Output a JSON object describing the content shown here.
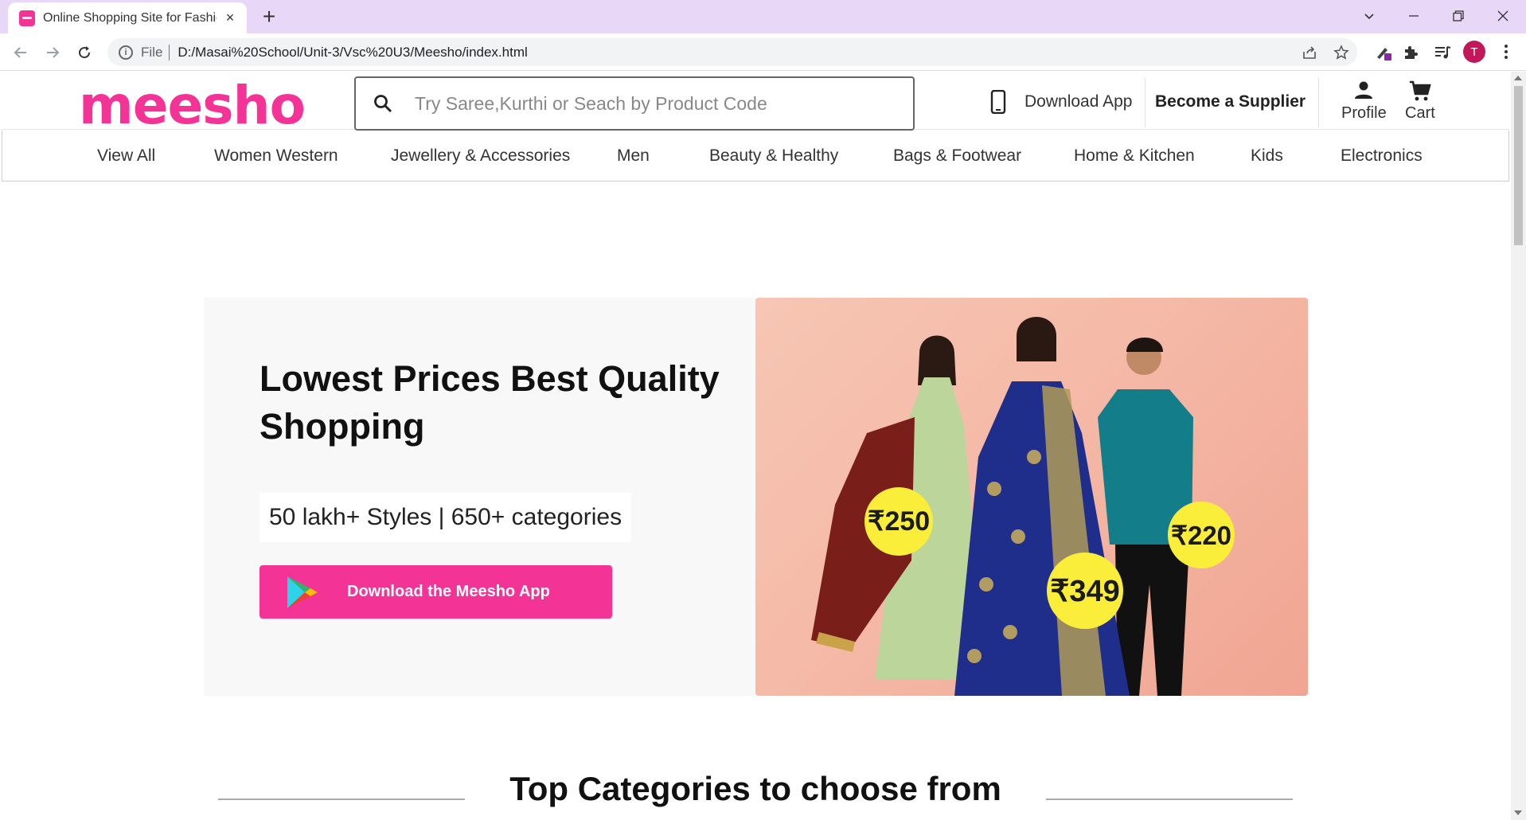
{
  "browser": {
    "tab_title": "Online Shopping Site for Fashion",
    "tab_close": "×",
    "new_tab": "+",
    "address_scheme": "File",
    "address_url": "D:/Masai%20School/Unit-3/Vsc%20U3/Meesho/index.html",
    "profile_initial": "T"
  },
  "header": {
    "logo": "meesho",
    "search_placeholder": "Try Saree,Kurthi or Seach by Product Code",
    "download_app": "Download App",
    "become_supplier": "Become a Supplier",
    "profile": "Profile",
    "cart": "Cart"
  },
  "categories": [
    "View All",
    "Women Western",
    "Jewellery & Accessories",
    "Men",
    "Beauty & Healthy",
    "Bags & Footwear",
    "Home & Kitchen",
    "Kids",
    "Electronics"
  ],
  "hero": {
    "title": "Lowest Prices Best Quality Shopping",
    "stats": "50 lakh+ Styles | 650+ categories",
    "button": "Download the Meesho App",
    "prices": [
      "₹250",
      "₹349",
      "₹220"
    ]
  },
  "section_title": "Top Categories to choose from",
  "colors": {
    "brand": "#f43397",
    "badge": "#fbee3a",
    "tabbar": "#e9d7f7"
  }
}
